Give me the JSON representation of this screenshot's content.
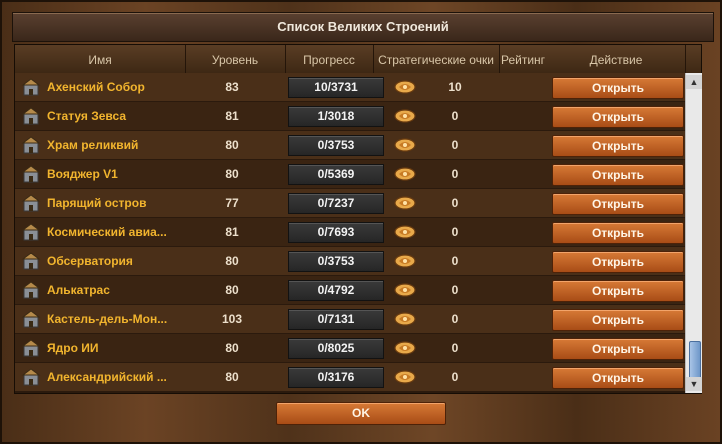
{
  "window": {
    "title": "Список Великих Строений"
  },
  "table": {
    "headers": {
      "name": "Имя",
      "level": "Уровень",
      "progress": "Прогресс",
      "strategy_points": "Стратегические очки",
      "rating": "Рейтинг",
      "action": "Действие"
    },
    "rows": [
      {
        "name": "Ахенский Собор",
        "level": "83",
        "progress": "10/3731",
        "points": "10",
        "action": "Открыть",
        "icon": "building-icon"
      },
      {
        "name": "Статуя Зевса",
        "level": "81",
        "progress": "1/3018",
        "points": "0",
        "action": "Открыть",
        "icon": "building-icon"
      },
      {
        "name": "Храм реликвий",
        "level": "80",
        "progress": "0/3753",
        "points": "0",
        "action": "Открыть",
        "icon": "building-icon"
      },
      {
        "name": "Вояджер V1",
        "level": "80",
        "progress": "0/5369",
        "points": "0",
        "action": "Открыть",
        "icon": "building-icon"
      },
      {
        "name": "Парящий остров",
        "level": "77",
        "progress": "0/7237",
        "points": "0",
        "action": "Открыть",
        "icon": "building-icon"
      },
      {
        "name": "Космический авиа...",
        "level": "81",
        "progress": "0/7693",
        "points": "0",
        "action": "Открыть",
        "icon": "building-icon"
      },
      {
        "name": "Обсерватория",
        "level": "80",
        "progress": "0/3753",
        "points": "0",
        "action": "Открыть",
        "icon": "building-icon"
      },
      {
        "name": "Алькатрас",
        "level": "80",
        "progress": "0/4792",
        "points": "0",
        "action": "Открыть",
        "icon": "building-icon"
      },
      {
        "name": "Кастель-дель-Мон...",
        "level": "103",
        "progress": "0/7131",
        "points": "0",
        "action": "Открыть",
        "icon": "building-icon"
      },
      {
        "name": "Ядро ИИ",
        "level": "80",
        "progress": "0/8025",
        "points": "0",
        "action": "Открыть",
        "icon": "building-icon"
      },
      {
        "name": "Александрийский ...",
        "level": "80",
        "progress": "0/3176",
        "points": "0",
        "action": "Открыть",
        "icon": "building-icon"
      }
    ]
  },
  "footer": {
    "ok_label": "OK"
  },
  "colors": {
    "name_text": "#f2b52e",
    "button": "#c0632a",
    "row_odd": "#4a2f18",
    "row_even": "#3a2412"
  }
}
